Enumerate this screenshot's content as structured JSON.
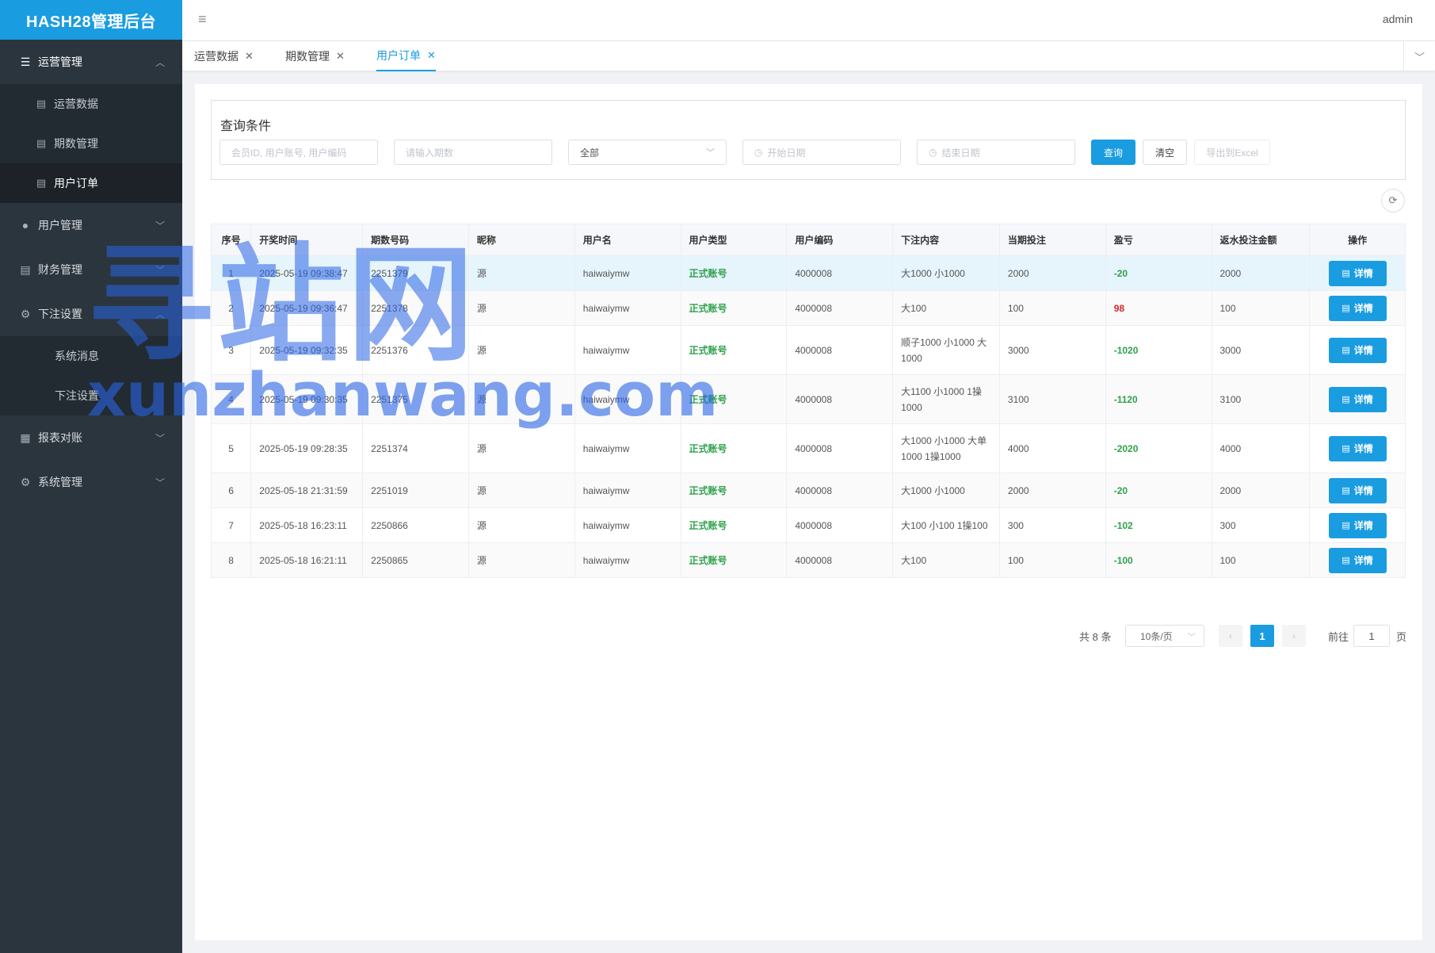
{
  "app": {
    "title": "HASH28管理后台",
    "user": "admin"
  },
  "sidebar": {
    "groups": [
      {
        "label": "运营管理",
        "icon": "list-icon",
        "expanded": true,
        "items": [
          {
            "label": "运营数据",
            "active": false
          },
          {
            "label": "期数管理",
            "active": false
          },
          {
            "label": "用户订单",
            "active": true
          }
        ]
      },
      {
        "label": "用户管理",
        "icon": "user-icon",
        "expanded": false
      },
      {
        "label": "财务管理",
        "icon": "document-icon",
        "expanded": false
      },
      {
        "label": "下注设置",
        "icon": "gear-icon",
        "expanded": true,
        "items": [
          {
            "label": "系统消息"
          },
          {
            "label": "下注设置"
          }
        ]
      },
      {
        "label": "报表对账",
        "icon": "report-icon",
        "expanded": false
      },
      {
        "label": "系统管理",
        "icon": "gear-icon",
        "expanded": false
      }
    ]
  },
  "tabs": [
    {
      "label": "运营数据",
      "active": false
    },
    {
      "label": "期数管理",
      "active": false
    },
    {
      "label": "用户订单",
      "active": true
    }
  ],
  "query": {
    "title": "查询条件",
    "member_placeholder": "会员ID, 用户账号, 用户编码",
    "period_placeholder": "请输入期数",
    "type_select_value": "全部",
    "start_date_placeholder": "开始日期",
    "end_date_placeholder": "结束日期",
    "search_label": "查询",
    "clear_label": "清空",
    "export_label": "导出到Excel"
  },
  "table": {
    "headers": [
      "序号",
      "开奖时间",
      "期数号码",
      "昵称",
      "用户名",
      "用户类型",
      "用户编码",
      "下注内容",
      "当期投注",
      "盈亏",
      "返水投注金额",
      "操作"
    ],
    "detail_label": "详情",
    "rows": [
      {
        "idx": "1",
        "time": "2025-05-19 09:38:47",
        "period": "2251379",
        "nick": "源",
        "username": "haiwaiymw",
        "type": "正式账号",
        "code": "4000008",
        "content": "大1000 小1000",
        "bet": "2000",
        "pl": "-20",
        "rebate": "2000"
      },
      {
        "idx": "2",
        "time": "2025-05-19 09:36:47",
        "period": "2251378",
        "nick": "源",
        "username": "haiwaiymw",
        "type": "正式账号",
        "code": "4000008",
        "content": "大100",
        "bet": "100",
        "pl": "98",
        "rebate": "100"
      },
      {
        "idx": "3",
        "time": "2025-05-19 09:32:35",
        "period": "2251376",
        "nick": "源",
        "username": "haiwaiymw",
        "type": "正式账号",
        "code": "4000008",
        "content": "顺子1000 小1000 大1000",
        "bet": "3000",
        "pl": "-1020",
        "rebate": "3000"
      },
      {
        "idx": "4",
        "time": "2025-05-19 09:30:35",
        "period": "2251375",
        "nick": "源",
        "username": "haiwaiymw",
        "type": "正式账号",
        "code": "4000008",
        "content": "大1100 小1000 1操1000",
        "bet": "3100",
        "pl": "-1120",
        "rebate": "3100"
      },
      {
        "idx": "5",
        "time": "2025-05-19 09:28:35",
        "period": "2251374",
        "nick": "源",
        "username": "haiwaiymw",
        "type": "正式账号",
        "code": "4000008",
        "content": "大1000 小1000 大单1000 1操1000",
        "bet": "4000",
        "pl": "-2020",
        "rebate": "4000"
      },
      {
        "idx": "6",
        "time": "2025-05-18 21:31:59",
        "period": "2251019",
        "nick": "源",
        "username": "haiwaiymw",
        "type": "正式账号",
        "code": "4000008",
        "content": "大1000 小1000",
        "bet": "2000",
        "pl": "-20",
        "rebate": "2000"
      },
      {
        "idx": "7",
        "time": "2025-05-18 16:23:11",
        "period": "2250866",
        "nick": "源",
        "username": "haiwaiymw",
        "type": "正式账号",
        "code": "4000008",
        "content": "大100 小100 1操100",
        "bet": "300",
        "pl": "-102",
        "rebate": "300"
      },
      {
        "idx": "8",
        "time": "2025-05-18 16:21:11",
        "period": "2250865",
        "nick": "源",
        "username": "haiwaiymw",
        "type": "正式账号",
        "code": "4000008",
        "content": "大100",
        "bet": "100",
        "pl": "-100",
        "rebate": "100"
      }
    ]
  },
  "pagination": {
    "total_text": "共 8 条",
    "page_size": "10条/页",
    "current_page": "1",
    "goto_label": "前往",
    "goto_value": "1",
    "page_suffix": "页"
  },
  "watermark": {
    "big": "寻站网",
    "small": "xunzhanwang.com"
  },
  "colors": {
    "accent": "#1a9ce0",
    "sidebar_bg": "#2b353d",
    "positive": "#d9252a",
    "negative": "#2ea14a"
  }
}
